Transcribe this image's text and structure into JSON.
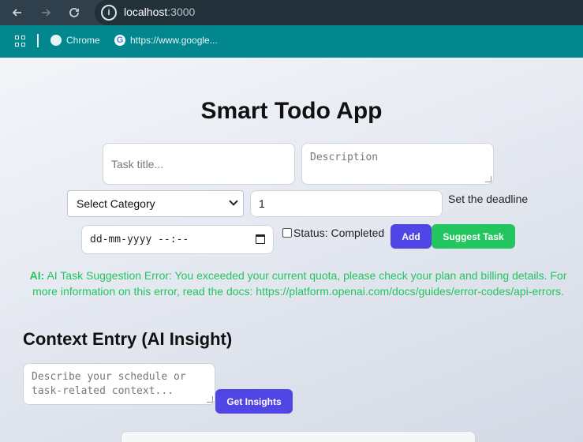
{
  "browser": {
    "url_host": "localhost",
    "url_port": ":3000",
    "bookmarks": [
      {
        "label": "Chrome",
        "icon": "chrome-globe-icon"
      },
      {
        "label": "https://www.google...",
        "icon": "google-icon"
      }
    ]
  },
  "app": {
    "title": "Smart Todo App",
    "task_title_placeholder": "Task title...",
    "description_placeholder": "Description",
    "category_selected": "Select Category",
    "priority_value": "1",
    "deadline_label": "Set the deadline",
    "date_placeholder": "dd-mm-yyyy --:--",
    "status_label": "Status: Completed",
    "add_label": "Add",
    "suggest_label": "Suggest Task",
    "ai_prefix": "AI:",
    "ai_message": "AI Task Suggestion Error: You exceeded your current quota, please check your plan and billing details. For more information on this error, read the docs: https://platform.openai.com/docs/guides/error-codes/api-errors.",
    "context_title": "Context Entry (AI Insight)",
    "context_placeholder": "Describe your schedule or task-related context...",
    "insights_label": "Get Insights"
  },
  "colors": {
    "accent": "#4f46e5",
    "success": "#22c55e",
    "chrome_bar": "#2f3f4b",
    "bookmark_bar": "#03878f"
  }
}
